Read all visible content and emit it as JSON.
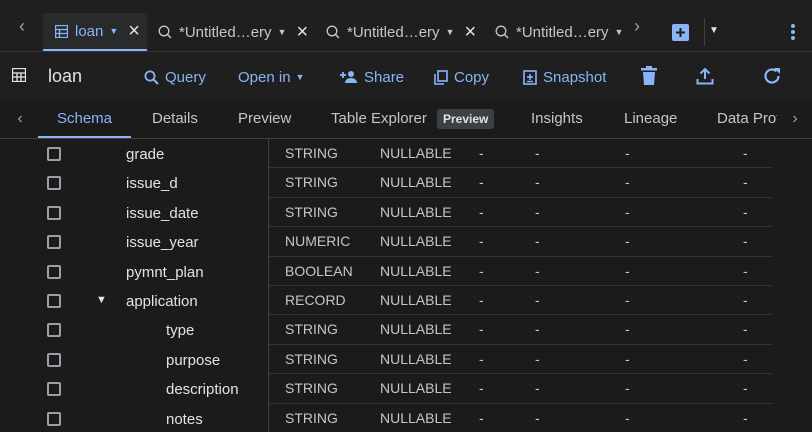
{
  "tabs": [
    {
      "label": "loan",
      "icon": "table-icon"
    },
    {
      "label": "*Untitled…ery",
      "icon": "query-icon"
    },
    {
      "label": "*Untitled…ery",
      "icon": "query-icon"
    },
    {
      "label": "*Untitled…ery",
      "icon": "query-icon"
    }
  ],
  "toolbar": {
    "title": "loan",
    "query": "Query",
    "open_in": "Open in",
    "share": "Share",
    "copy": "Copy",
    "snapshot": "Snapshot"
  },
  "subtabs": {
    "schema": "Schema",
    "details": "Details",
    "preview": "Preview",
    "table_explorer": "Table Explorer",
    "badge": "Preview",
    "insights": "Insights",
    "lineage": "Lineage",
    "data_profile": "Data Prof"
  },
  "rows": [
    {
      "name": "grade",
      "type": "STRING",
      "mode": "NULLABLE",
      "nested": false,
      "expandable": false
    },
    {
      "name": "issue_d",
      "type": "STRING",
      "mode": "NULLABLE",
      "nested": false,
      "expandable": false
    },
    {
      "name": "issue_date",
      "type": "STRING",
      "mode": "NULLABLE",
      "nested": false,
      "expandable": false
    },
    {
      "name": "issue_year",
      "type": "NUMERIC",
      "mode": "NULLABLE",
      "nested": false,
      "expandable": false
    },
    {
      "name": "pymnt_plan",
      "type": "BOOLEAN",
      "mode": "NULLABLE",
      "nested": false,
      "expandable": false
    },
    {
      "name": "application",
      "type": "RECORD",
      "mode": "NULLABLE",
      "nested": false,
      "expandable": true
    },
    {
      "name": "type",
      "type": "STRING",
      "mode": "NULLABLE",
      "nested": true,
      "expandable": false
    },
    {
      "name": "purpose",
      "type": "STRING",
      "mode": "NULLABLE",
      "nested": true,
      "expandable": false
    },
    {
      "name": "description",
      "type": "STRING",
      "mode": "NULLABLE",
      "nested": true,
      "expandable": false
    },
    {
      "name": "notes",
      "type": "STRING",
      "mode": "NULLABLE",
      "nested": true,
      "expandable": false
    }
  ],
  "empty_cell": "-",
  "colors": {
    "accent": "#8ab4f8",
    "bg": "#1b1b1b",
    "text": "#e3e3e3"
  }
}
